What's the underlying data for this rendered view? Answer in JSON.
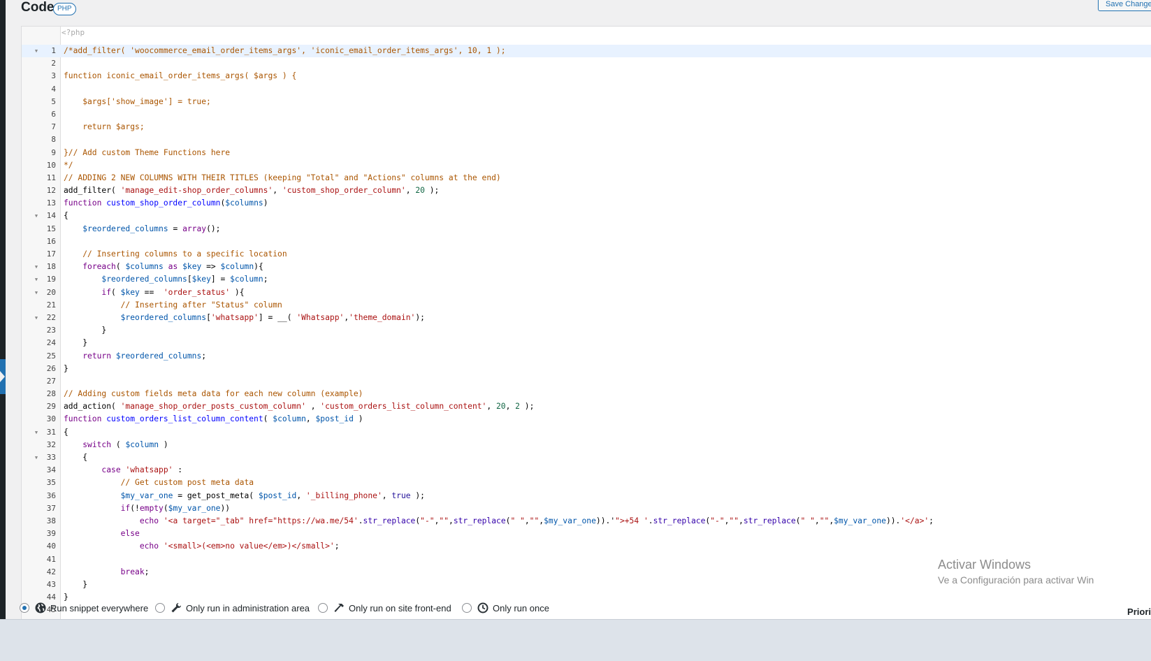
{
  "header": {
    "title": "Code",
    "language_badge": "PHP",
    "save_label": "Save Changes"
  },
  "editor": {
    "open_tag": "<?php",
    "lines": [
      {
        "n": "1",
        "fold": true,
        "active": true,
        "seg": [
          [
            "c-comment",
            "/*add_filter( 'woocommerce_email_order_items_args', 'iconic_email_order_items_args', 10, 1 );"
          ]
        ]
      },
      {
        "n": "2",
        "seg": []
      },
      {
        "n": "3",
        "seg": [
          [
            "c-comment",
            "function iconic_email_order_items_args( $args ) {"
          ]
        ]
      },
      {
        "n": "4",
        "seg": []
      },
      {
        "n": "5",
        "seg": [
          [
            "c-comment",
            "    $args['show_image'] = true;"
          ]
        ]
      },
      {
        "n": "6",
        "seg": []
      },
      {
        "n": "7",
        "seg": [
          [
            "c-comment",
            "    return $args;"
          ]
        ]
      },
      {
        "n": "8",
        "seg": []
      },
      {
        "n": "9",
        "seg": [
          [
            "c-comment",
            "}// Add custom Theme Functions here"
          ]
        ]
      },
      {
        "n": "10",
        "seg": [
          [
            "c-comment",
            "*/"
          ]
        ]
      },
      {
        "n": "11",
        "seg": [
          [
            "c-comment",
            "// ADDING 2 NEW COLUMNS WITH THEIR TITLES (keeping \"Total\" and \"Actions\" columns at the end)"
          ]
        ]
      },
      {
        "n": "12",
        "seg": [
          [
            "c-plain",
            "add_filter( "
          ],
          [
            "c-str",
            "'manage_edit-shop_order_columns'"
          ],
          [
            "c-plain",
            ", "
          ],
          [
            "c-str",
            "'custom_shop_order_column'"
          ],
          [
            "c-plain",
            ", "
          ],
          [
            "c-num",
            "20"
          ],
          [
            "c-plain",
            " );"
          ]
        ]
      },
      {
        "n": "13",
        "seg": [
          [
            "c-kw",
            "function "
          ],
          [
            "c-def",
            "custom_shop_order_column"
          ],
          [
            "c-plain",
            "("
          ],
          [
            "c-var",
            "$columns"
          ],
          [
            "c-plain",
            ")"
          ]
        ]
      },
      {
        "n": "14",
        "fold": true,
        "seg": [
          [
            "c-plain",
            "{"
          ]
        ]
      },
      {
        "n": "15",
        "seg": [
          [
            "c-plain",
            "    "
          ],
          [
            "c-var",
            "$reordered_columns"
          ],
          [
            "c-plain",
            " = "
          ],
          [
            "c-kw",
            "array"
          ],
          [
            "c-plain",
            "();"
          ]
        ]
      },
      {
        "n": "16",
        "seg": []
      },
      {
        "n": "17",
        "seg": [
          [
            "c-comment",
            "    // Inserting columns to a specific location"
          ]
        ]
      },
      {
        "n": "18",
        "fold": true,
        "seg": [
          [
            "c-plain",
            "    "
          ],
          [
            "c-kw",
            "foreach"
          ],
          [
            "c-plain",
            "( "
          ],
          [
            "c-var",
            "$columns"
          ],
          [
            "c-plain",
            " "
          ],
          [
            "c-kw",
            "as"
          ],
          [
            "c-plain",
            " "
          ],
          [
            "c-var",
            "$key"
          ],
          [
            "c-plain",
            " => "
          ],
          [
            "c-var",
            "$column"
          ],
          [
            "c-plain",
            "){"
          ]
        ]
      },
      {
        "n": "19",
        "fold": true,
        "seg": [
          [
            "c-plain",
            "        "
          ],
          [
            "c-var",
            "$reordered_columns"
          ],
          [
            "c-plain",
            "["
          ],
          [
            "c-var",
            "$key"
          ],
          [
            "c-plain",
            "] = "
          ],
          [
            "c-var",
            "$column"
          ],
          [
            "c-plain",
            ";"
          ]
        ]
      },
      {
        "n": "20",
        "fold": true,
        "seg": [
          [
            "c-plain",
            "        "
          ],
          [
            "c-kw",
            "if"
          ],
          [
            "c-plain",
            "( "
          ],
          [
            "c-var",
            "$key"
          ],
          [
            "c-plain",
            " ==  "
          ],
          [
            "c-str",
            "'order_status'"
          ],
          [
            "c-plain",
            " ){"
          ]
        ]
      },
      {
        "n": "21",
        "seg": [
          [
            "c-comment",
            "            // Inserting after \"Status\" column"
          ]
        ]
      },
      {
        "n": "22",
        "fold": true,
        "seg": [
          [
            "c-plain",
            "            "
          ],
          [
            "c-var",
            "$reordered_columns"
          ],
          [
            "c-plain",
            "["
          ],
          [
            "c-str",
            "'whatsapp'"
          ],
          [
            "c-plain",
            "] = __( "
          ],
          [
            "c-str",
            "'Whatsapp'"
          ],
          [
            "c-plain",
            ","
          ],
          [
            "c-str",
            "'theme_domain'"
          ],
          [
            "c-plain",
            ");"
          ]
        ]
      },
      {
        "n": "23",
        "seg": [
          [
            "c-plain",
            "        }"
          ]
        ]
      },
      {
        "n": "24",
        "seg": [
          [
            "c-plain",
            "    }"
          ]
        ]
      },
      {
        "n": "25",
        "seg": [
          [
            "c-plain",
            "    "
          ],
          [
            "c-kw",
            "return"
          ],
          [
            "c-plain",
            " "
          ],
          [
            "c-var",
            "$reordered_columns"
          ],
          [
            "c-plain",
            ";"
          ]
        ]
      },
      {
        "n": "26",
        "seg": [
          [
            "c-plain",
            "}"
          ]
        ]
      },
      {
        "n": "27",
        "seg": []
      },
      {
        "n": "28",
        "seg": [
          [
            "c-comment",
            "// Adding custom fields meta data for each new column (example)"
          ]
        ]
      },
      {
        "n": "29",
        "seg": [
          [
            "c-plain",
            "add_action( "
          ],
          [
            "c-str",
            "'manage_shop_order_posts_custom_column'"
          ],
          [
            "c-plain",
            " , "
          ],
          [
            "c-str",
            "'custom_orders_list_column_content'"
          ],
          [
            "c-plain",
            ", "
          ],
          [
            "c-num",
            "20"
          ],
          [
            "c-plain",
            ", "
          ],
          [
            "c-num",
            "2"
          ],
          [
            "c-plain",
            " );"
          ]
        ]
      },
      {
        "n": "30",
        "seg": [
          [
            "c-kw",
            "function "
          ],
          [
            "c-def",
            "custom_orders_list_column_content"
          ],
          [
            "c-plain",
            "( "
          ],
          [
            "c-var",
            "$column"
          ],
          [
            "c-plain",
            ", "
          ],
          [
            "c-var",
            "$post_id"
          ],
          [
            "c-plain",
            " )"
          ]
        ]
      },
      {
        "n": "31",
        "fold": true,
        "seg": [
          [
            "c-plain",
            "{"
          ]
        ]
      },
      {
        "n": "32",
        "seg": [
          [
            "c-plain",
            "    "
          ],
          [
            "c-kw",
            "switch"
          ],
          [
            "c-plain",
            " ( "
          ],
          [
            "c-var",
            "$column"
          ],
          [
            "c-plain",
            " )"
          ]
        ]
      },
      {
        "n": "33",
        "fold": true,
        "seg": [
          [
            "c-plain",
            "    {"
          ]
        ]
      },
      {
        "n": "34",
        "seg": [
          [
            "c-plain",
            "        "
          ],
          [
            "c-kw",
            "case"
          ],
          [
            "c-plain",
            " "
          ],
          [
            "c-str",
            "'whatsapp'"
          ],
          [
            "c-plain",
            " :"
          ]
        ]
      },
      {
        "n": "35",
        "seg": [
          [
            "c-comment",
            "            // Get custom post meta data"
          ]
        ]
      },
      {
        "n": "36",
        "seg": [
          [
            "c-plain",
            "            "
          ],
          [
            "c-var",
            "$my_var_one"
          ],
          [
            "c-plain",
            " = get_post_meta( "
          ],
          [
            "c-var",
            "$post_id"
          ],
          [
            "c-plain",
            ", "
          ],
          [
            "c-str",
            "'_billing_phone'"
          ],
          [
            "c-plain",
            ", "
          ],
          [
            "c-atom",
            "true"
          ],
          [
            "c-plain",
            " );"
          ]
        ]
      },
      {
        "n": "37",
        "seg": [
          [
            "c-plain",
            "            "
          ],
          [
            "c-kw",
            "if"
          ],
          [
            "c-plain",
            "(!"
          ],
          [
            "c-kw",
            "empty"
          ],
          [
            "c-plain",
            "("
          ],
          [
            "c-var",
            "$my_var_one"
          ],
          [
            "c-plain",
            "))"
          ]
        ]
      },
      {
        "n": "38",
        "seg": [
          [
            "c-plain",
            "                "
          ],
          [
            "c-kw",
            "echo"
          ],
          [
            "c-plain",
            " "
          ],
          [
            "c-str",
            "'<a target=\"_tab\" href=\"https://wa.me/54'"
          ],
          [
            "c-plain",
            "."
          ],
          [
            "c-builtin",
            "str_replace"
          ],
          [
            "c-plain",
            "("
          ],
          [
            "c-str",
            "\"-\""
          ],
          [
            "c-plain",
            ","
          ],
          [
            "c-str",
            "\"\""
          ],
          [
            "c-plain",
            ","
          ],
          [
            "c-builtin",
            "str_replace"
          ],
          [
            "c-plain",
            "("
          ],
          [
            "c-str",
            "\" \""
          ],
          [
            "c-plain",
            ","
          ],
          [
            "c-str",
            "\"\""
          ],
          [
            "c-plain",
            ","
          ],
          [
            "c-var",
            "$my_var_one"
          ],
          [
            "c-plain",
            ")).'"
          ],
          [
            "c-str",
            "\">+54 '"
          ],
          [
            "c-plain",
            "."
          ],
          [
            "c-builtin",
            "str_replace"
          ],
          [
            "c-plain",
            "("
          ],
          [
            "c-str",
            "\"-\""
          ],
          [
            "c-plain",
            ","
          ],
          [
            "c-str",
            "\"\""
          ],
          [
            "c-plain",
            ","
          ],
          [
            "c-builtin",
            "str_replace"
          ],
          [
            "c-plain",
            "("
          ],
          [
            "c-str",
            "\" \""
          ],
          [
            "c-plain",
            ","
          ],
          [
            "c-str",
            "\"\""
          ],
          [
            "c-plain",
            ","
          ],
          [
            "c-var",
            "$my_var_one"
          ],
          [
            "c-plain",
            "))."
          ],
          [
            "c-str",
            "'</a>'"
          ],
          [
            "c-plain",
            ";"
          ]
        ]
      },
      {
        "n": "39",
        "seg": [
          [
            "c-plain",
            "            "
          ],
          [
            "c-kw",
            "else"
          ]
        ]
      },
      {
        "n": "40",
        "seg": [
          [
            "c-plain",
            "                "
          ],
          [
            "c-kw",
            "echo"
          ],
          [
            "c-plain",
            " "
          ],
          [
            "c-str",
            "'<small>(<em>no value</em>)</small>'"
          ],
          [
            "c-plain",
            ";"
          ]
        ]
      },
      {
        "n": "41",
        "seg": []
      },
      {
        "n": "42",
        "seg": [
          [
            "c-plain",
            "            "
          ],
          [
            "c-kw",
            "break"
          ],
          [
            "c-plain",
            ";"
          ]
        ]
      },
      {
        "n": "43",
        "seg": [
          [
            "c-plain",
            "    }"
          ]
        ]
      },
      {
        "n": "44",
        "seg": [
          [
            "c-plain",
            "}"
          ]
        ]
      },
      {
        "n": "45",
        "seg": []
      }
    ]
  },
  "watermark": {
    "line1": "Activar Windows",
    "line2": "Ve a Configuración para activar Win"
  },
  "run_options": [
    {
      "label": "Run snippet everywhere",
      "icon": "globe-icon",
      "checked": true
    },
    {
      "label": "Only run in administration area",
      "icon": "wrench-icon",
      "checked": false
    },
    {
      "label": "Only run on site front-end",
      "icon": "hammer-icon",
      "checked": false
    },
    {
      "label": "Only run once",
      "icon": "clock-icon",
      "checked": false
    }
  ],
  "priority_label": "Priori",
  "colors": {
    "accent": "#2271b1",
    "admin_bar": "#1d2327",
    "comment": "#aa5500",
    "keyword": "#770088",
    "string": "#aa1111",
    "variable": "#0055aa"
  }
}
